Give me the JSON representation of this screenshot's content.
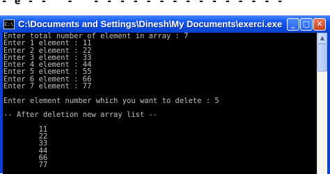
{
  "window": {
    "title": "C:\\Documents and Settings\\Dinesh\\My Documents\\exerci.exe",
    "icon_label": "C:\\",
    "controls": {
      "minimize": "_",
      "maximize": "□",
      "close": "✕"
    }
  },
  "top_strip": {
    "text": "- e - - ' - ' - - - - - - - - - - - - - - -"
  },
  "console": {
    "lines": [
      "Enter total number of element in array : 7",
      "Enter 1 element : 11",
      "Enter 2 element : 22",
      "Enter 3 element : 33",
      "Enter 4 element : 44",
      "Enter 5 element : 55",
      "Enter 6 element : 66",
      "Enter 7 element : 77",
      "",
      "Enter element number which you want to delete : 5",
      "",
      "-- After deletion new array list --",
      "",
      "        11",
      "        22",
      "        33",
      "        44",
      "        66",
      "        77"
    ]
  },
  "scrollbar": {
    "up_arrow": "▲"
  }
}
